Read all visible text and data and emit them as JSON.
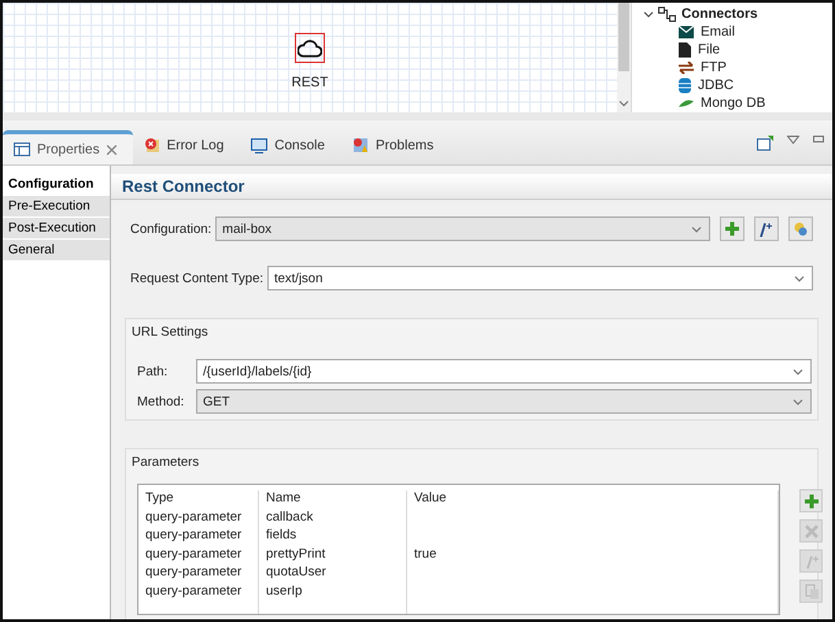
{
  "diagram": {
    "node": {
      "label": "REST",
      "selected": true
    }
  },
  "palette": {
    "group": {
      "label": "Connectors",
      "expanded": true
    },
    "items": [
      {
        "label": "Email",
        "kind": "email"
      },
      {
        "label": "File",
        "kind": "file"
      },
      {
        "label": "FTP",
        "kind": "ftp"
      },
      {
        "label": "JDBC",
        "kind": "jdbc"
      },
      {
        "label": "Mongo DB",
        "kind": "mongo"
      }
    ]
  },
  "view_tabs": [
    {
      "label": "Properties",
      "kind": "properties",
      "selected": true
    },
    {
      "label": "Error Log",
      "kind": "errorlog",
      "selected": false
    },
    {
      "label": "Console",
      "kind": "console",
      "selected": false
    },
    {
      "label": "Problems",
      "kind": "problems",
      "selected": false
    }
  ],
  "sidebar": {
    "items": [
      {
        "label": "Configuration",
        "selected": true
      },
      {
        "label": "Pre-Execution",
        "selected": false
      },
      {
        "label": "Post-Execution",
        "selected": false
      },
      {
        "label": "General",
        "selected": false
      }
    ]
  },
  "section_title": "Rest Connector",
  "configuration": {
    "label": "Configuration:",
    "value": "mail-box"
  },
  "request_content_type": {
    "label": "Request Content Type:",
    "value": "text/json"
  },
  "url_settings": {
    "title": "URL Settings",
    "path": {
      "label": "Path:",
      "value": "/{userId}/labels/{id}"
    },
    "method": {
      "label": "Method:",
      "value": "GET"
    }
  },
  "parameters": {
    "title": "Parameters",
    "columns": [
      "Type",
      "Name",
      "Value"
    ],
    "rows": [
      {
        "type": "query-parameter",
        "name": "callback"
      },
      {
        "type": "query-parameter",
        "name": "fields"
      },
      {
        "type": "query-parameter",
        "name": "prettyPrint",
        "value": "true"
      },
      {
        "type": "query-parameter",
        "name": "quotaUser"
      },
      {
        "type": "query-parameter",
        "name": "userIp"
      }
    ],
    "buttons": [
      {
        "kind": "add",
        "disabled": false
      },
      {
        "kind": "delete",
        "disabled": true
      },
      {
        "kind": "comment",
        "disabled": true
      },
      {
        "kind": "copy",
        "disabled": true
      }
    ]
  }
}
